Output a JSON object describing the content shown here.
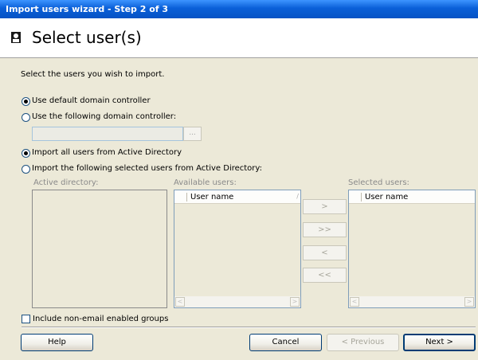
{
  "window": {
    "title": "Import users wizard - Step 2 of 3"
  },
  "header": {
    "icon": "user-icon",
    "title": "Select user(s)"
  },
  "instructions": "Select the users you wish to import.",
  "domain": {
    "default_label": "Use default domain controller",
    "custom_label": "Use the following domain controller:",
    "controller_value": "",
    "browse_label": "..."
  },
  "import": {
    "all_label": "Import all users from Active Directory",
    "selected_label": "Import the following selected users from Active Directory:"
  },
  "panels": {
    "active_directory_label": "Active directory:",
    "available_label": "Available users:",
    "selected_label": "Selected users:",
    "column_header": "User name"
  },
  "move_buttons": {
    "add": ">",
    "add_all": ">>",
    "remove": "<",
    "remove_all": "<<"
  },
  "include_groups_label": "Include non-email enabled groups",
  "footer": {
    "help": "Help",
    "cancel": "Cancel",
    "previous": "< Previous",
    "next": "Next >"
  },
  "colors": {
    "titlebar": "#0a5fd8",
    "face": "#ece9d8",
    "disabled_text": "#a7a69b"
  }
}
